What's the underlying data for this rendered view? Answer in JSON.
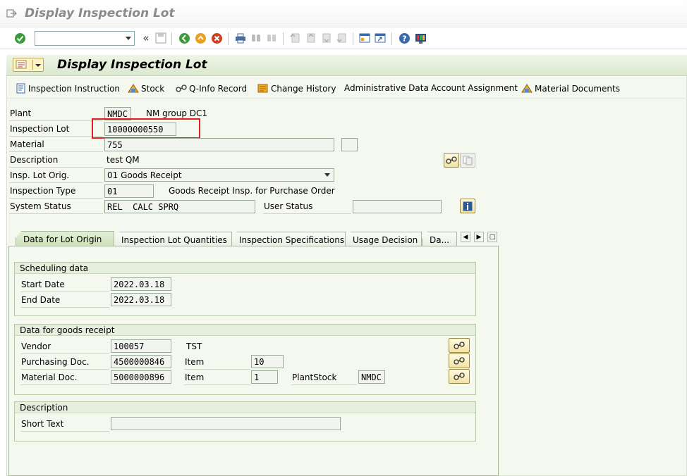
{
  "window": {
    "title": "Display Inspection Lot"
  },
  "toolbar": {
    "command_field_value": "",
    "double_arrow": "«"
  },
  "header": {
    "title": "Display Inspection Lot"
  },
  "app_toolbar": [
    {
      "label": "Inspection Instruction",
      "icon": "document-icon"
    },
    {
      "label": "Stock",
      "icon": "stock-icon"
    },
    {
      "label": "Q-Info Record",
      "icon": "glasses-icon"
    },
    {
      "label": "Change History",
      "icon": "history-icon"
    },
    {
      "label": "Administrative Data",
      "icon": ""
    },
    {
      "label": "Account Assignment",
      "icon": ""
    },
    {
      "label": "Material Documents",
      "icon": "stock-icon"
    }
  ],
  "fields": {
    "plant": {
      "label": "Plant",
      "value": "NMDC",
      "text": "NM group DC1"
    },
    "inspection_lot": {
      "label": "Inspection Lot",
      "value": "10000000550"
    },
    "material": {
      "label": "Material",
      "value": "755"
    },
    "description": {
      "label": "Description",
      "value": "test QM"
    },
    "insp_lot_orig": {
      "label": "Insp. Lot Orig.",
      "value": "01 Goods Receipt"
    },
    "inspection_type": {
      "label": "Inspection Type",
      "value": "01",
      "text": "Goods Receipt Insp. for Purchase Order"
    },
    "system_status": {
      "label": "System Status",
      "value": "REL  CALC SPRQ"
    },
    "user_status": {
      "label": "User Status",
      "value": ""
    }
  },
  "tabs": [
    {
      "label": "Data for Lot Origin",
      "active": true
    },
    {
      "label": "Inspection Lot Quantities",
      "active": false
    },
    {
      "label": "Inspection Specifications",
      "active": false
    },
    {
      "label": "Usage Decision",
      "active": false
    },
    {
      "label": "Da...",
      "active": false
    }
  ],
  "scheduling": {
    "title": "Scheduling data",
    "start_date": {
      "label": "Start Date",
      "value": "2022.03.18"
    },
    "end_date": {
      "label": "End Date",
      "value": "2022.03.18"
    }
  },
  "goods_receipt": {
    "title": "Data for goods receipt",
    "vendor": {
      "label": "Vendor",
      "value": "100057",
      "text": "TST"
    },
    "purchasing_doc": {
      "label": "Purchasing Doc.",
      "value": "4500000846",
      "item_label": "Item",
      "item": "10"
    },
    "material_doc": {
      "label": "Material Doc.",
      "value": "5000000896",
      "item_label": "Item",
      "item": "1",
      "plantstock_label": "PlantStock",
      "plantstock": "NMDC"
    }
  },
  "description_group": {
    "title": "Description",
    "short_text": {
      "label": "Short Text",
      "value": ""
    }
  },
  "colors": {
    "highlight": "#e02020",
    "panel": "#f4f8ef",
    "header": "#dbe9cf"
  }
}
